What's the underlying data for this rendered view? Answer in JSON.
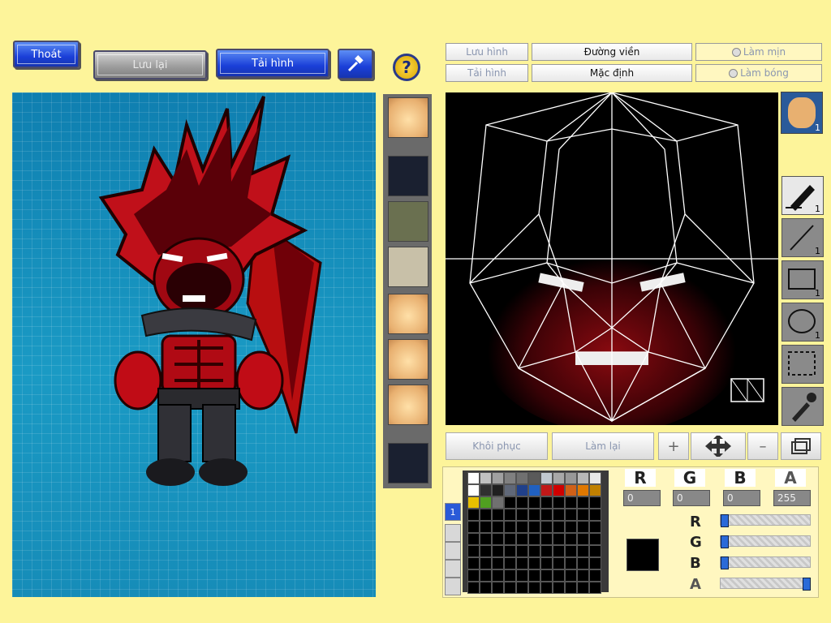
{
  "toolbar": {
    "exit_label": "Thoát",
    "save_label": "Lưu lại",
    "reload_label": "Tải hình",
    "hammer_icon": "hammer-icon",
    "help_label": "?"
  },
  "editor_toolbar": {
    "save_image": "Lưu hình",
    "load_image": "Tải hình",
    "outline": "Đường viền",
    "default": "Mặc định",
    "smooth": "Làm mịn",
    "gloss": "Làm bóng"
  },
  "tools": [
    {
      "name": "pen-tool",
      "count": "1"
    },
    {
      "name": "line-tool",
      "count": "1"
    },
    {
      "name": "rect-tool",
      "count": "1"
    },
    {
      "name": "ellipse-tool",
      "count": "1"
    },
    {
      "name": "select-tool",
      "count": ""
    },
    {
      "name": "eyedropper-tool",
      "count": ""
    }
  ],
  "face_preview_count": "1",
  "bottom_buttons": {
    "restore": "Khôi phục",
    "redo": "Làm lại"
  },
  "color": {
    "labels": [
      "R",
      "G",
      "B",
      "A"
    ],
    "values": [
      "0",
      "0",
      "0",
      "255"
    ],
    "current": "#000000",
    "alpha_fraction": 1.0,
    "rgb_fraction": [
      0,
      0,
      0
    ]
  },
  "palette": {
    "swatches": [
      "#ffffff",
      "#c0c0c0",
      "#a0a0a0",
      "#808080",
      "#707070",
      "#5a5a5a",
      "#c0c8d0",
      "#a8a8a8",
      "#989898",
      "#b8b8b8",
      "#e8e8e8",
      "#ffffff",
      "#303030",
      "#202020",
      "#606878",
      "#20408a",
      "#2060c0",
      "#c01818",
      "#d00000",
      "#d06018",
      "#e07800",
      "#c08000",
      "#e8c000",
      "#50a020",
      "#707070"
    ],
    "tab_label": "1"
  }
}
